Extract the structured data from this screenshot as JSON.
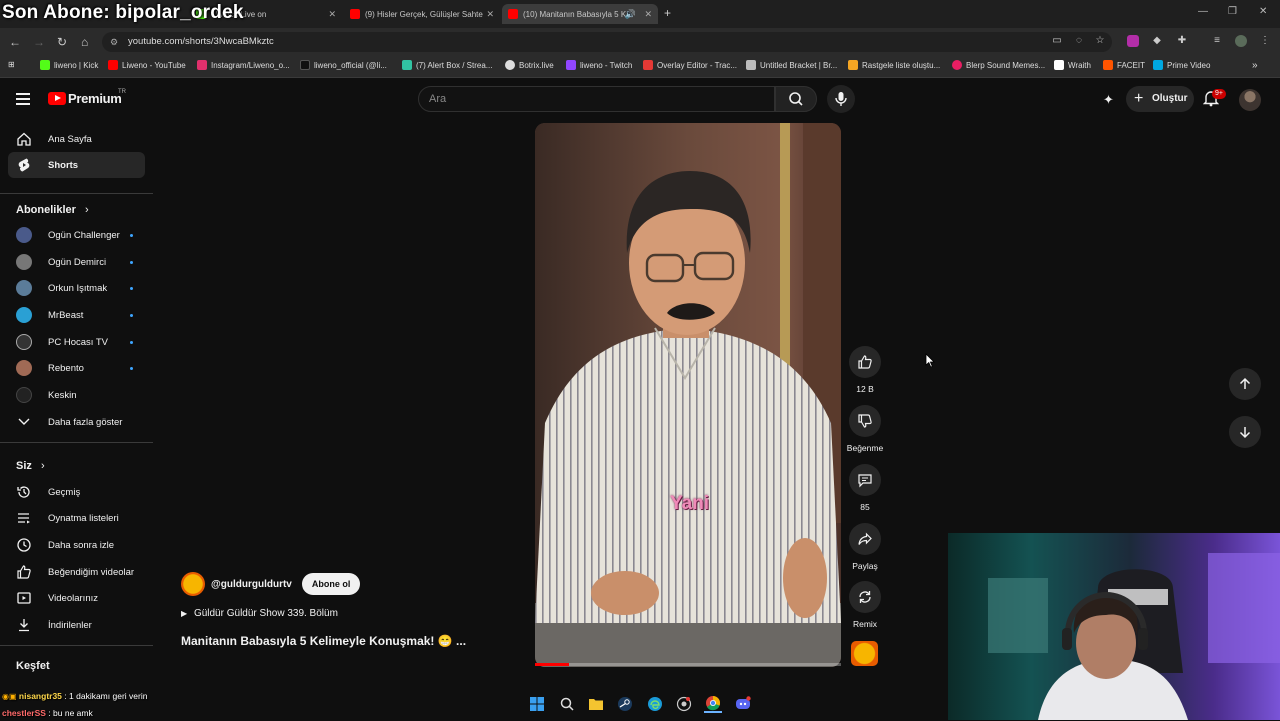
{
  "stream_overlay": {
    "title": "Son Abone: bipolar_ordek"
  },
  "browser": {
    "tabs": [
      {
        "label": "- Watch Live on",
        "color": "#53fc18"
      },
      {
        "label": "(9) Hisler Gerçek, Gülüşler Sahte",
        "color": "#ff0000"
      },
      {
        "label": "(10) Manitanın Babasıyla 5 K",
        "color": "#ff0000",
        "active": true
      }
    ],
    "new_tab": "+",
    "url": "youtube.com/shorts/3NwcaBMkztc",
    "bookmarks": [
      {
        "label": "liweno | Kick",
        "color": "#53fc18"
      },
      {
        "label": "Liweno - YouTube",
        "color": "#ff0000"
      },
      {
        "label": "Instagram/Liweno_o...",
        "color": "#e1306c"
      },
      {
        "label": "liweno_official (@li...",
        "color": "#111111"
      },
      {
        "label": "(7) Alert Box / Strea...",
        "color": "#31c3a2"
      },
      {
        "label": "Botrix.live",
        "color": "#dddddd"
      },
      {
        "label": "liweno - Twitch",
        "color": "#9146ff"
      },
      {
        "label": "Overlay Editor - Trac...",
        "color": "#e53935"
      },
      {
        "label": "Untitled Bracket | Br...",
        "color": "#bbbbbb"
      },
      {
        "label": "Rastgele liste oluştu...",
        "color": "#f5a623"
      },
      {
        "label": "Blerp Sound Memes...",
        "color": "#e91e63"
      },
      {
        "label": "Wraith",
        "color": "#ffffff"
      },
      {
        "label": "FACEIT",
        "color": "#ff5500"
      },
      {
        "label": "Prime Video",
        "color": "#00a8e1"
      }
    ]
  },
  "header": {
    "logo": "Premium",
    "logo_region": "TR",
    "search_placeholder": "Ara",
    "create_label": "Oluştur",
    "notif_count": "9+"
  },
  "sidebar": {
    "main": [
      {
        "label": "Ana Sayfa",
        "icon": "home-icon"
      },
      {
        "label": "Shorts",
        "icon": "shorts-icon",
        "active": true
      }
    ],
    "subs_heading": "Abonelikler",
    "subs": [
      {
        "label": "Ogün Challenger",
        "color": "#4a5a8a"
      },
      {
        "label": "Ogün Demirci",
        "color": "#777777"
      },
      {
        "label": "Orkun Işıtmak",
        "color": "#5b7c99"
      },
      {
        "label": "MrBeast",
        "color": "#2aa0d4"
      },
      {
        "label": "PC Hocası TV",
        "color": "#333333"
      },
      {
        "label": "Rebento",
        "color": "#a06a55"
      },
      {
        "label": "Keskin",
        "color": "#222222"
      }
    ],
    "show_more": "Daha fazla göster",
    "you_heading": "Siz",
    "you": [
      {
        "label": "Geçmiş",
        "icon": "history-icon"
      },
      {
        "label": "Oynatma listeleri",
        "icon": "playlists-icon"
      },
      {
        "label": "Daha sonra izle",
        "icon": "watch-later-icon"
      },
      {
        "label": "Beğendiğim videolar",
        "icon": "liked-icon"
      },
      {
        "label": "Videolarınız",
        "icon": "your-videos-icon"
      },
      {
        "label": "İndirilenler",
        "icon": "downloads-icon"
      }
    ],
    "explore_heading": "Keşfet"
  },
  "short": {
    "caption": "Yani",
    "progress": 0.11,
    "channel": "@guldurguldurtv",
    "subscribe": "Abone ol",
    "playlist": "Güldür Güldür Show 339. Bölüm",
    "title": "Manitanın Babasıyla 5 Kelimeyle Konuşmak! 😁 ...",
    "likes": "12 B",
    "dislike": "Beğenme",
    "comments": "85",
    "share": "Paylaş",
    "remix": "Remix"
  },
  "chat": [
    {
      "user": "nisangtr35",
      "msg": ": 1 dakikamı geri verin",
      "color": "#ffd84a"
    },
    {
      "user": "chestlerSS",
      "msg": ": bu ne amk",
      "color": "#ff6a6a"
    }
  ]
}
